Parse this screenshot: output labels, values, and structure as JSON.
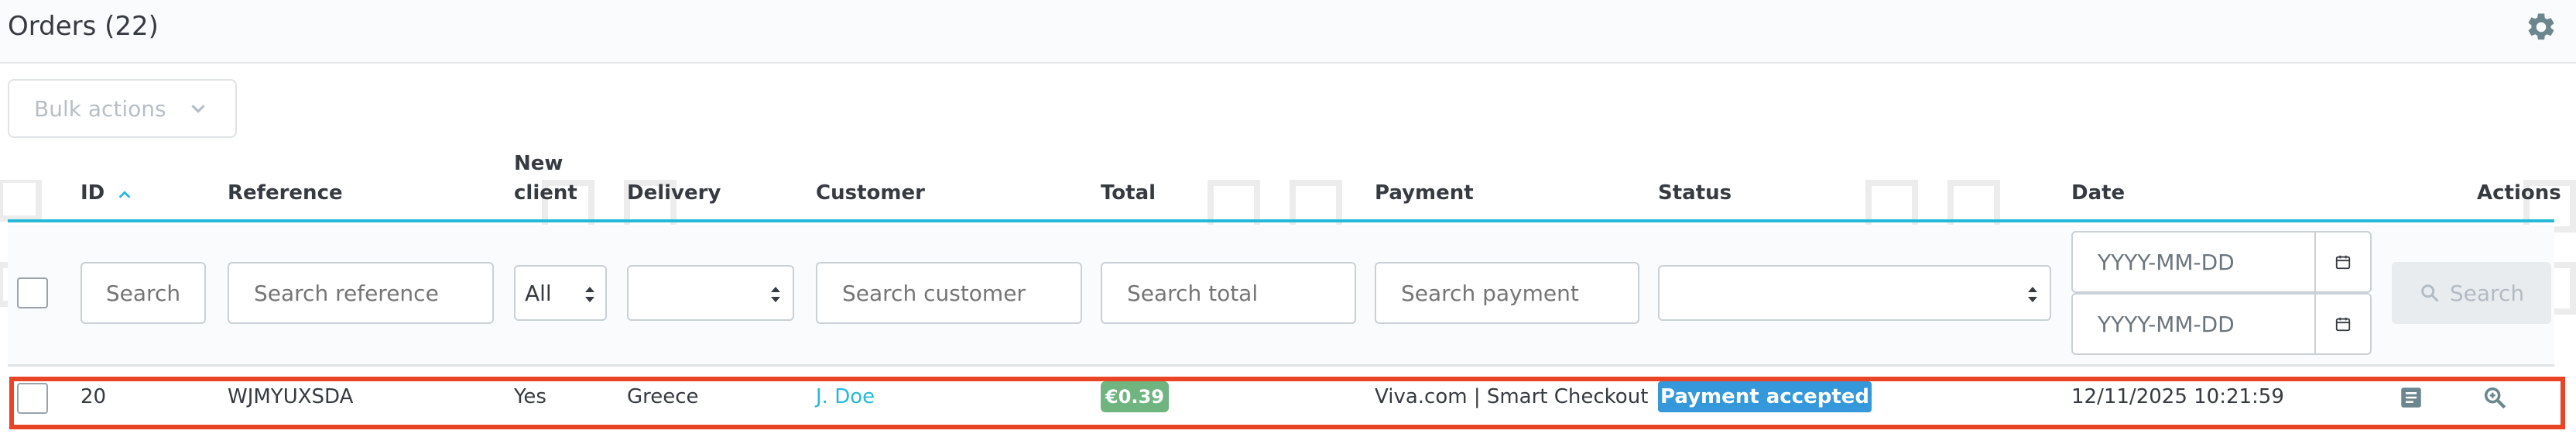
{
  "header": {
    "title": "Orders (22)",
    "settings_icon": "gear-icon"
  },
  "toolbar": {
    "bulk_actions_label": "Bulk actions"
  },
  "columns": {
    "id": "ID",
    "reference": "Reference",
    "new_client_line1": "New",
    "new_client_line2": "client",
    "delivery": "Delivery",
    "customer": "Customer",
    "total": "Total",
    "payment": "Payment",
    "status": "Status",
    "date": "Date",
    "actions": "Actions"
  },
  "filters": {
    "id_placeholder": "Search",
    "reference_placeholder": "Search reference",
    "new_client_value": "All",
    "delivery_value": "",
    "customer_placeholder": "Search customer",
    "total_placeholder": "Search total",
    "payment_placeholder": "Search payment",
    "status_value": "",
    "date_from_placeholder": "YYYY-MM-DD",
    "date_to_placeholder": "YYYY-MM-DD",
    "search_button": "Search"
  },
  "orders": [
    {
      "id": "20",
      "reference": "WJMYUXSDA",
      "new_client": "Yes",
      "delivery": "Greece",
      "customer": "J. Doe",
      "total": "€0.39",
      "payment": "Viva.com | Smart Checkout",
      "status": "Payment accepted",
      "date": "12/11/2025 10:21:59"
    }
  ],
  "colors": {
    "accent": "#25b9d7",
    "highlight_border": "#e84425",
    "total_badge": "#70b580",
    "status_badge": "#3498db"
  }
}
